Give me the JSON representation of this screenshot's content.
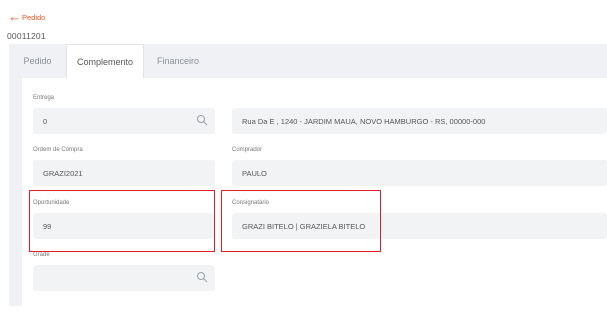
{
  "header": {
    "back_label": "Pedido",
    "order_number": "00011201"
  },
  "tabs": [
    {
      "label": "Pedido",
      "active": false
    },
    {
      "label": "Complemento",
      "active": true
    },
    {
      "label": "Financeiro",
      "active": false
    }
  ],
  "form": {
    "entrega": {
      "label": "Entrega",
      "value": "0"
    },
    "endereco": {
      "value": "Rua Da E , 1240 - JARDIM MAUA, NOVO HAMBURGO - RS, 00000-000"
    },
    "ordem_compra": {
      "label": "Ordem de Compra",
      "value": "GRAZI2021"
    },
    "comprador": {
      "label": "Comprador",
      "value": "PAULO"
    },
    "oportunidade": {
      "label": "Oportunidade",
      "value": "99"
    },
    "consignatario": {
      "label": "Consignatário",
      "value": "GRAZI BITELO | GRAZIELA BITELO"
    },
    "grade": {
      "label": "Grade",
      "value": ""
    }
  },
  "colors": {
    "accent": "#e8541f",
    "highlight": "#e11d2a",
    "field_bg": "#f2f3f5"
  },
  "icons": [
    "arrow-left-icon",
    "search-icon"
  ]
}
